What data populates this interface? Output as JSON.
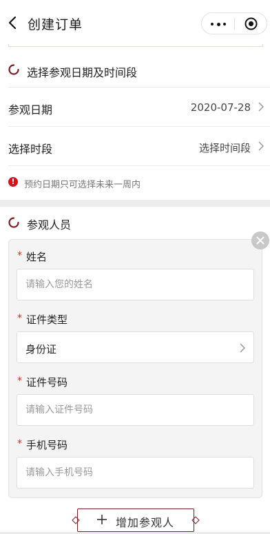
{
  "header": {
    "title": "创建订单",
    "back_icon": "chevron-left-icon",
    "more_icon": "more-dots-icon",
    "close_icon": "record-circle-icon"
  },
  "colors": {
    "accent": "#7a1c22",
    "warning": "#d3141d",
    "required": "#c0392b"
  },
  "date_section": {
    "title": "选择参观日期及时间段",
    "rows": [
      {
        "label": "参观日期",
        "value": "2020-07-28"
      },
      {
        "label": "选择时段",
        "value": "选择时间段"
      }
    ],
    "notice": "预约日期只可选择未来一周内"
  },
  "visitor_section": {
    "title": "参观人员",
    "fields": {
      "name": {
        "required_mark": "*",
        "label": "姓名",
        "placeholder": "请输入您的姓名",
        "value": ""
      },
      "id_type": {
        "required_mark": "*",
        "label": "证件类型",
        "value": "身份证"
      },
      "id_number": {
        "required_mark": "*",
        "label": "证件号码",
        "placeholder": "请输入证件号码",
        "value": ""
      },
      "phone": {
        "required_mark": "*",
        "label": "手机号码",
        "placeholder": "请输入手机号码",
        "value": ""
      }
    },
    "add_button": {
      "label": "增加参观人"
    }
  }
}
